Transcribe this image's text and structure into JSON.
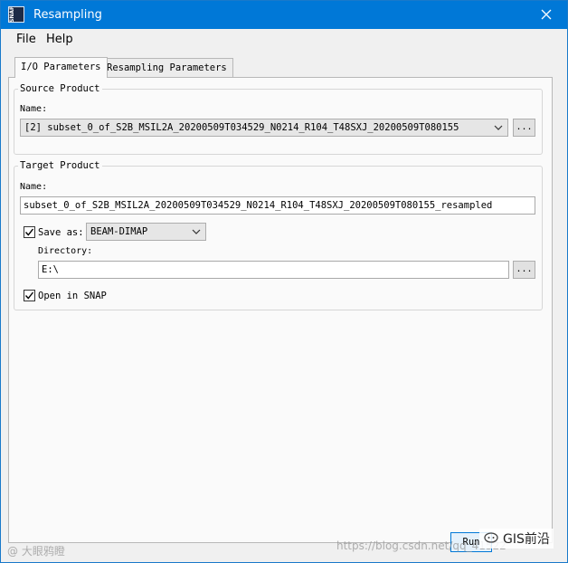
{
  "window": {
    "title": "Resampling"
  },
  "menu": {
    "items": [
      "File",
      "Help"
    ]
  },
  "tabs": [
    {
      "label": "I/O Parameters",
      "active": true
    },
    {
      "label": "Resampling Parameters",
      "active": false
    }
  ],
  "source_product": {
    "group_title": "Source Product",
    "name_label": "Name:",
    "selected": "[2] subset_0_of_S2B_MSIL2A_20200509T034529_N0214_R104_T48SXJ_20200509T080155",
    "browse_label": "..."
  },
  "target_product": {
    "group_title": "Target Product",
    "name_label": "Name:",
    "name_value": "subset_0_of_S2B_MSIL2A_20200509T034529_N0214_R104_T48SXJ_20200509T080155_resampled",
    "save_as_label": "Save as:",
    "save_as_checked": true,
    "format_selected": "BEAM-DIMAP",
    "directory_label": "Directory:",
    "directory_value": "E:\\",
    "browse_label": "...",
    "open_in_snap_label": "Open in SNAP",
    "open_in_snap_checked": true
  },
  "buttons": {
    "run_label": "Run"
  },
  "watermarks": {
    "left": "@ 大眼鸦瞪",
    "url": "https://blog.csdn.net/qq_41522",
    "brand": "GIS前沿"
  },
  "icons": {
    "app": "snap-app-icon",
    "close": "close-icon",
    "combo": "chevron-down-icon",
    "check": "checkmark-icon"
  },
  "colors": {
    "titlebar": "#0078d7",
    "accent": "#0078d7"
  }
}
